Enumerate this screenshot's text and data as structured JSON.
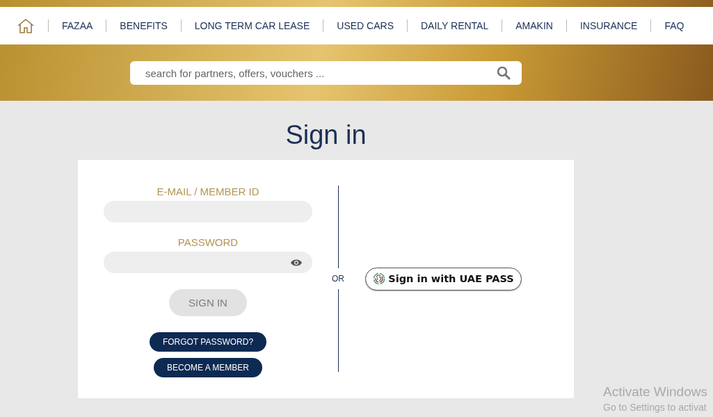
{
  "nav": {
    "items": [
      {
        "label": "FAZAA"
      },
      {
        "label": "BENEFITS"
      },
      {
        "label": "LONG TERM CAR LEASE"
      },
      {
        "label": "USED CARS"
      },
      {
        "label": "DAILY RENTAL"
      },
      {
        "label": "AMAKIN"
      },
      {
        "label": "INSURANCE"
      },
      {
        "label": "FAQ"
      }
    ]
  },
  "search": {
    "placeholder": "search for partners, offers, vouchers ..."
  },
  "title": "Sign in",
  "form": {
    "email_label": "E-MAIL / MEMBER ID",
    "password_label": "PASSWORD",
    "submit": {
      "label": "SIGN IN",
      "disabled": true
    },
    "links": [
      {
        "label": "FORGOT PASSWORD?"
      },
      {
        "label": "BECOME A MEMBER"
      }
    ]
  },
  "divider_label": "OR",
  "uae_pass": {
    "label": "Sign in with UAE PASS"
  },
  "os_notice": {
    "title": "Activate Windows",
    "subtitle": "Go to Settings to activat"
  }
}
